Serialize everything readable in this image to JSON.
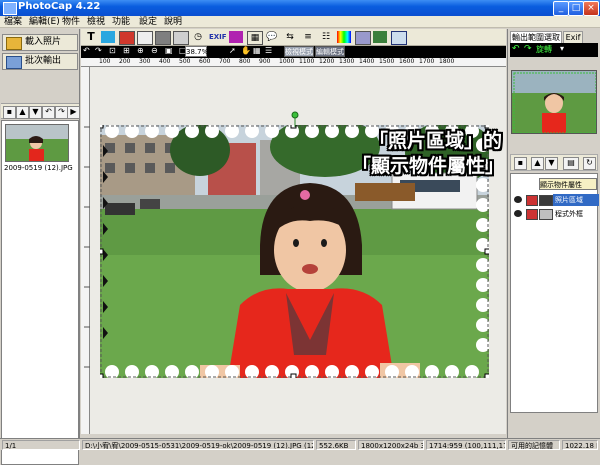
{
  "window": {
    "title": "PhotoCap 4.22",
    "minimize_icon": "minimize-icon",
    "maximize_icon": "maximize-icon",
    "close_icon": "close-icon"
  },
  "menu": [
    "檔案",
    "編輯(E)",
    "物件",
    "檢視",
    "功能",
    "設定",
    "說明"
  ],
  "left_panel": {
    "load_button": "載入照片",
    "batch_button": "批次輸出",
    "thumbnail_filename": "2009-0519 (12).JPG"
  },
  "toolbar": {
    "zoom_value": "38.7%",
    "mode_a": "檢視模式",
    "mode_b": "編輯模式",
    "ruler_ticks": [
      "100",
      "200",
      "300",
      "400",
      "500",
      "600",
      "700",
      "800",
      "900",
      "1000",
      "1100",
      "1200",
      "1300",
      "1400",
      "1500",
      "1600",
      "1700",
      "1800"
    ]
  },
  "right_panel": {
    "tab_active": "輸出範圍選取",
    "tab_other": "Exif",
    "rotate_label": "旋轉",
    "layers": [
      {
        "label": "顯示物件屬性"
      },
      {
        "label": "照片區域"
      },
      {
        "label": "程式外框"
      }
    ],
    "memory_label": "可用的記憶體",
    "memory_value": "1022.18 M"
  },
  "annotation": {
    "line1": "「照片區域」的",
    "line2": "「顯示物件屬性」"
  },
  "status_bar": {
    "page": "1/1",
    "path": "D:\\小宥\\宥\\2009-0515-0531\\2009-0519-ok\\2009-0519 (12).JPG (1280×960x24)",
    "filesize": "552.6KB",
    "resolution": "1800x1200x24b 300DPI",
    "cursor_info": "1714:959 (100,111,17)"
  },
  "colors": {
    "titlebar": "#0a5ddf",
    "selection": "#316ac5",
    "arrow": "#e00000"
  }
}
